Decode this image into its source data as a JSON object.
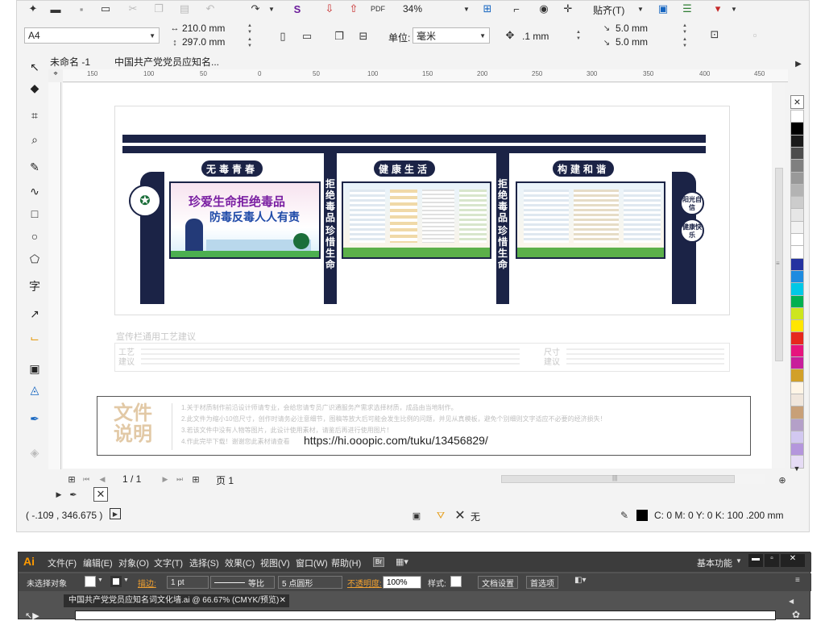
{
  "toolbar1": {
    "zoom": "34%",
    "snap": "贴齐(T)"
  },
  "toolbar2": {
    "page_size": "A4",
    "width": "210.0 mm",
    "height": "297.0 mm",
    "unit_label": "单位:",
    "unit_value": "毫米",
    "nudge": ".1 mm",
    "dup_x": "5.0 mm",
    "dup_y": "5.0 mm"
  },
  "tabs": [
    {
      "label": "未命名 -1"
    },
    {
      "label": "中国共产党党员应知名..."
    }
  ],
  "ruler": {
    "ticks": [
      "150",
      "100",
      "50",
      "0",
      "50",
      "100",
      "150",
      "200",
      "250",
      "300",
      "350",
      "400",
      "450"
    ]
  },
  "design": {
    "headers": [
      "无毒青春",
      "健康生活",
      "构建和谐"
    ],
    "pillar_left": "拒绝毒品",
    "pillar_right": "珍惜生命",
    "pillar2_left": "拒绝毒品",
    "pillar2_right": "珍惜生命",
    "banner_line1": "珍爱生命拒绝毒品",
    "banner_line2": "防毒反毒人人有责",
    "badge1": "阳光自信",
    "badge2": "健康快乐",
    "craft_title": "宣传栏通用工艺建议",
    "craft_left": "工艺建议",
    "craft_right": "尺寸建议",
    "notes_title": "文件说明",
    "notes": [
      "1.关于材质制作前沿设计师请专业，会给您请专员广识通服务产需求选择材质，成品由当地制作。",
      "2.此文件为缩小10倍尺寸，创作时请务必注意细节，图稿等放大后可能会发生比例的问题，并见从真模板，避免个别细则文字适应不必要的经济损失！",
      "3.若该文件中没有人物等图片，此设计使用素材，请鉴后再进行使用图片！",
      "4.作此完毕下载！谢谢您此素材请查看"
    ],
    "url": "https://hi.ooopic.com/tuku/13456829/"
  },
  "pager": {
    "page": "1 / 1",
    "page_tab": "页 1"
  },
  "status": {
    "coords": "( -.109 , 346.675 )",
    "fill": "无",
    "outline": "C: 0 M: 0 Y: 0 K: 100  .200 mm"
  },
  "palette": [
    "#ffffff",
    "#000000",
    "#1a1a1a",
    "#4d4d4d",
    "#808080",
    "#999999",
    "#b3b3b3",
    "#cccccc",
    "#e6e6e6",
    "#f2f2f2",
    "#ffffff",
    "#ffffff",
    "#2432a0",
    "#1e8be0",
    "#00c8e6",
    "#00b050",
    "#cde61e",
    "#ffe600",
    "#e6281e",
    "#e6147d",
    "#c81e9b",
    "#d2a028",
    "#fff5e6",
    "#f0e6dc",
    "#c8a078",
    "#b4a0c8",
    "#d2c8f0",
    "#b496dc",
    "#e6dcf5"
  ],
  "ai": {
    "logo": "Ai",
    "menu": [
      "文件(F)",
      "编辑(E)",
      "对象(O)",
      "文字(T)",
      "选择(S)",
      "效果(C)",
      "视图(V)",
      "窗口(W)",
      "帮助(H)"
    ],
    "workspace": "基本功能",
    "no_selection": "未选择对象",
    "stroke_label": "描边:",
    "stroke_value": "1 pt",
    "line_style": "等比",
    "brush": "5 点圆形",
    "opacity_label": "不透明度:",
    "opacity_value": "100%",
    "style_label": "样式:",
    "doc_settings": "文档设置",
    "preferences": "首选项",
    "doc_tab": "中国共产党党员应知名词文化墙.ai @ 66.67% (CMYK/预览)"
  }
}
